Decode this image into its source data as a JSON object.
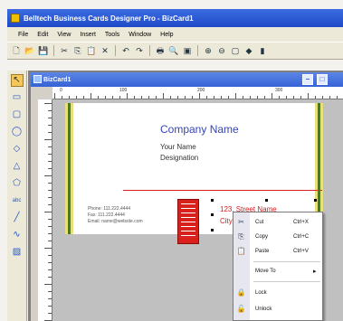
{
  "window": {
    "title": "Belltech Business Cards Designer Pro - BizCard1"
  },
  "menu": {
    "items": [
      "File",
      "Edit",
      "View",
      "Insert",
      "Tools",
      "Window",
      "Help"
    ]
  },
  "toolbar": {
    "buttons": [
      {
        "name": "new-icon",
        "glyph": "🗋"
      },
      {
        "name": "open-icon",
        "glyph": "📂"
      },
      {
        "name": "save-icon",
        "glyph": "💾"
      },
      {
        "name": "cut-icon",
        "glyph": "✂"
      },
      {
        "name": "copy-icon",
        "glyph": "⎘"
      },
      {
        "name": "paste-icon",
        "glyph": "📋"
      },
      {
        "name": "delete-icon",
        "glyph": "✕"
      },
      {
        "name": "undo-icon",
        "glyph": "↶"
      },
      {
        "name": "redo-icon",
        "glyph": "↷"
      },
      {
        "name": "print-icon",
        "glyph": "🖶"
      },
      {
        "name": "print-preview-icon",
        "glyph": "🔍"
      },
      {
        "name": "image-icon",
        "glyph": "▣"
      },
      {
        "name": "zoom-in-icon",
        "glyph": "⊕"
      },
      {
        "name": "zoom-out-icon",
        "glyph": "⊖"
      },
      {
        "name": "frame-icon",
        "glyph": "▢"
      },
      {
        "name": "color-icon",
        "glyph": "◆"
      },
      {
        "name": "more-icon",
        "glyph": "▮"
      }
    ]
  },
  "toolbox": {
    "tools": [
      {
        "name": "pointer-tool-icon",
        "glyph": "↖",
        "active": true
      },
      {
        "name": "rectangle-tool-icon",
        "glyph": "▭"
      },
      {
        "name": "rounded-rectangle-tool-icon",
        "glyph": "▢"
      },
      {
        "name": "ellipse-tool-icon",
        "glyph": "◯"
      },
      {
        "name": "diamond-tool-icon",
        "glyph": "◇"
      },
      {
        "name": "triangle-tool-icon",
        "glyph": "△"
      },
      {
        "name": "polygon-tool-icon",
        "glyph": "⬠"
      },
      {
        "name": "text-tool-icon",
        "glyph": "abc"
      },
      {
        "name": "line-tool-icon",
        "glyph": "╱"
      },
      {
        "name": "curve-tool-icon",
        "glyph": "∿"
      },
      {
        "name": "image-tool-icon",
        "glyph": "▨"
      }
    ]
  },
  "document": {
    "title": "BizCard1",
    "ruler_numbers": [
      "0",
      "100",
      "200",
      "300"
    ]
  },
  "card": {
    "company": "Company Name",
    "name": "Your Name",
    "designation": "Designation",
    "phone": "Phone: 111.222.4444",
    "fax": "Fax: 111.222.4444",
    "email": "Email: name@website.com",
    "street": "123, Street Name",
    "city": "City/Ctry"
  },
  "context_menu": {
    "items": [
      {
        "label": "Cut",
        "shortcut": "Ctrl+X",
        "icon": "cut-icon",
        "glyph": "✂"
      },
      {
        "label": "Copy",
        "shortcut": "Ctrl+C",
        "icon": "copy-icon",
        "glyph": "⎘"
      },
      {
        "label": "Paste",
        "shortcut": "Ctrl+V",
        "icon": "paste-icon",
        "glyph": "📋"
      },
      {
        "label": "Move To",
        "shortcut": "",
        "icon": "",
        "glyph": "",
        "submenu": true
      },
      {
        "label": "Lock",
        "shortcut": "",
        "icon": "lock-icon",
        "glyph": "🔒"
      },
      {
        "label": "Unlock",
        "shortcut": "",
        "icon": "unlock-icon",
        "glyph": "🔓"
      }
    ]
  },
  "colors": {
    "titlebar": "#1f49c8",
    "company_text": "#3644b8",
    "address_text": "#d11e1e",
    "logo_red": "#d8211c",
    "card_border_yellow": "#e6e07a",
    "card_border_green": "#3c7e2c"
  }
}
